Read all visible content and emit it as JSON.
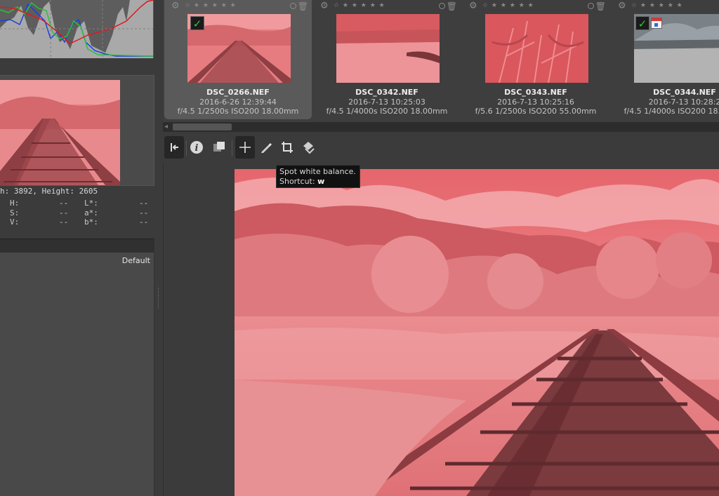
{
  "left_panel": {
    "image_info": "h: 3892, Height: 2605",
    "readouts": {
      "h": {
        "label": "H:",
        "value": "--"
      },
      "s": {
        "label": "S:",
        "value": "--"
      },
      "v": {
        "label": "V:",
        "value": "--"
      },
      "l": {
        "label": "L*:",
        "value": "--"
      },
      "a": {
        "label": "a*:",
        "value": "--"
      },
      "b": {
        "label": "b*:",
        "value": "--"
      }
    },
    "profile_label": "Default"
  },
  "filmstrip": {
    "thumbnails": [
      {
        "name": "DSC_0266.NEF",
        "date": "2016-6-26 12:39:44",
        "exif": "f/4.5 1/2500s ISO200 18.00mm",
        "selected": true,
        "check": "✓"
      },
      {
        "name": "DSC_0342.NEF",
        "date": "2016-7-13 10:25:03",
        "exif": "f/4.5 1/4000s ISO200 18.00mm",
        "selected": false
      },
      {
        "name": "DSC_0343.NEF",
        "date": "2016-7-13 10:25:16",
        "exif": "f/5.6 1/2500s ISO200 55.00mm",
        "selected": false
      },
      {
        "name": "DSC_0344.NEF",
        "date": "2016-7-13 10:28:2",
        "exif": "f/4.5 1/4000s ISO200 18.00mm",
        "selected": false,
        "check": "✓"
      }
    ],
    "stars": "☆ ★ ★ ★ ★ ★"
  },
  "toolbar": {
    "tooltip_line1": "Spot white balance.",
    "tooltip_line2_prefix": "Shortcut: ",
    "tooltip_shortcut": "w"
  },
  "colors": {
    "ir_red": "#e06b70",
    "panel": "#3b3b3b",
    "check_green": "#2ec73a"
  }
}
